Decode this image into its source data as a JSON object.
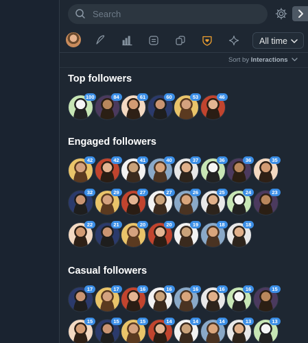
{
  "search": {
    "placeholder": "Search"
  },
  "icons": {
    "search": "search-icon",
    "settings": "gear-icon",
    "expand": "chevron-right-icon",
    "tabs": [
      "feather-icon",
      "bar-chart-icon",
      "list-icon",
      "copy-icon",
      "heart-shield-icon",
      "sparkle-icon"
    ]
  },
  "colors": {
    "badge": "#3b8ee6",
    "active_tab": "#f0a030",
    "panel_bg": "#1e2732"
  },
  "filter": {
    "range_label": "All time"
  },
  "sort": {
    "prefix": "Sort by",
    "value": "Interactions"
  },
  "sections": {
    "top": {
      "title": "Top followers",
      "counts": [
        "100",
        "84",
        "61",
        "60",
        "53",
        "46"
      ]
    },
    "engaged": {
      "title": "Engaged followers",
      "counts": [
        "42",
        "42",
        "41",
        "40",
        "37",
        "36",
        "36",
        "35",
        "32",
        "29",
        "27",
        "27",
        "26",
        "25",
        "24",
        "23",
        "22",
        "21",
        "20",
        "20",
        "19",
        "18",
        "18"
      ]
    },
    "casual": {
      "title": "Casual followers",
      "counts": [
        "17",
        "17",
        "16",
        "16",
        "16",
        "16",
        "16",
        "15",
        "15",
        "15",
        "15",
        "14",
        "14",
        "14",
        "13",
        "13"
      ]
    }
  }
}
